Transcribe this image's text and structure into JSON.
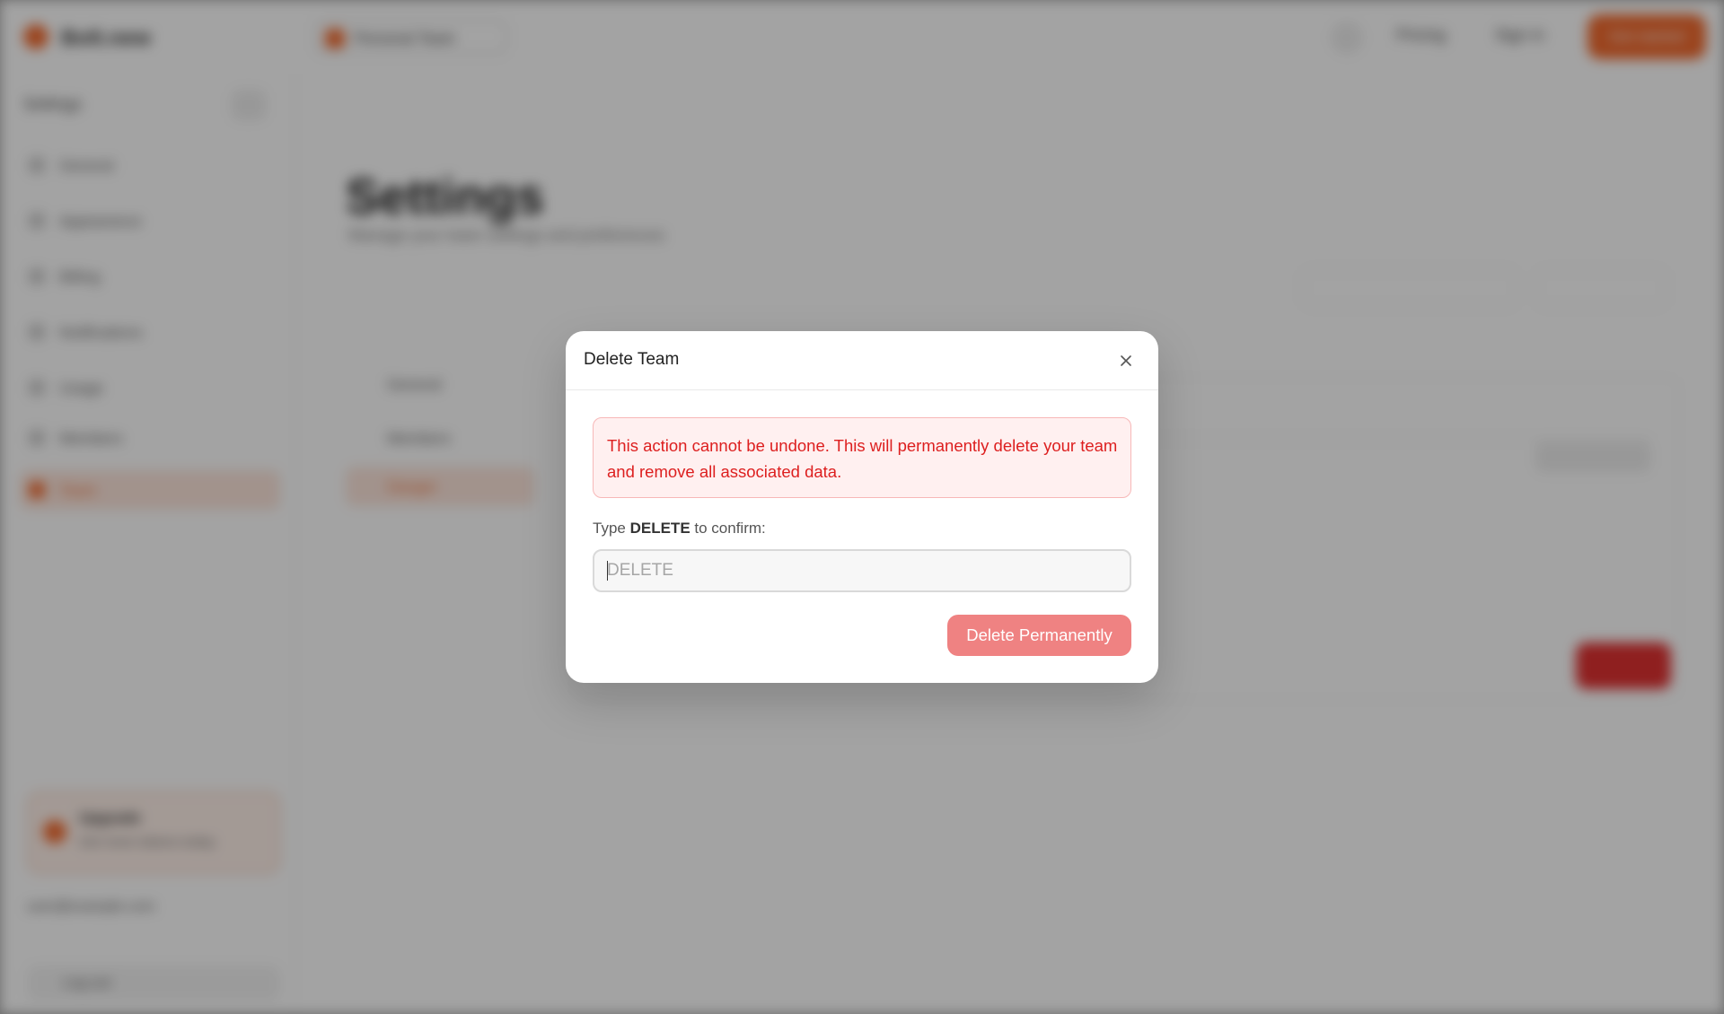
{
  "background": {
    "app_name": "Bolt.new",
    "team_chip": "Personal Team",
    "topbar_links": [
      "Pricing",
      "Sign in"
    ],
    "topbar_cta": "Get started",
    "sidebar": {
      "title": "Settings",
      "items": [
        {
          "label": "General",
          "active": false
        },
        {
          "label": "Appearance",
          "active": false
        },
        {
          "label": "Billing",
          "active": false
        },
        {
          "label": "Notifications",
          "active": false
        },
        {
          "label": "Usage",
          "active": false
        },
        {
          "label": "Members",
          "active": false
        },
        {
          "label": "Team",
          "active": true
        }
      ],
      "promo_title": "Upgrade",
      "promo_text": "Get more tokens today",
      "user": "user@example.com",
      "bottom": "Log out"
    },
    "main": {
      "title": "Settings",
      "subtitle": "Manage your team settings and preferences",
      "tabs": [
        {
          "label": "General",
          "active": false
        },
        {
          "label": "Members",
          "active": false
        },
        {
          "label": "Danger",
          "active": true
        }
      ]
    }
  },
  "modal": {
    "title": "Delete Team",
    "warning": "This action cannot be undone. This will permanently delete your team and remove all associated data.",
    "confirm_prefix": "Type ",
    "confirm_keyword": "DELETE",
    "confirm_suffix": " to confirm:",
    "input_placeholder": "DELETE",
    "input_value": "",
    "delete_button": "Delete Permanently",
    "colors": {
      "danger_text": "#dd1f1f",
      "danger_bg": "#fff0f0",
      "button_disabled": "#ef8282"
    }
  }
}
